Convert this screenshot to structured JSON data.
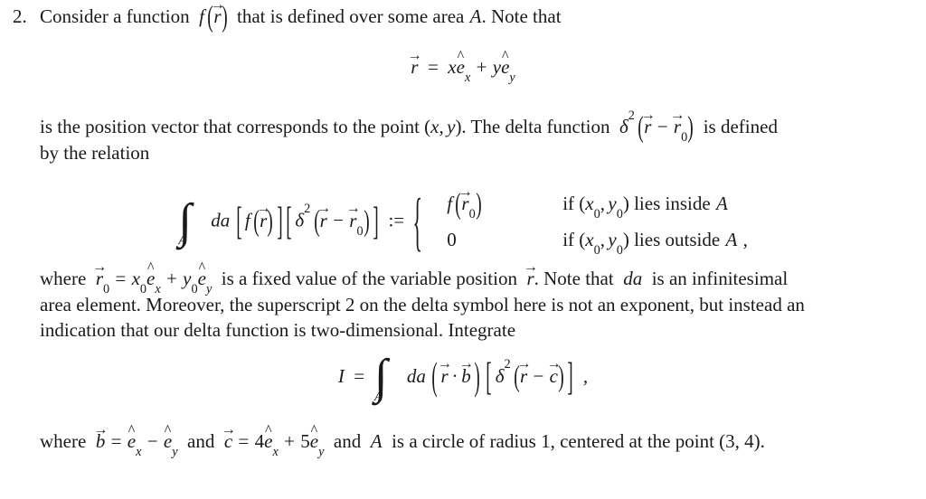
{
  "document": {
    "kind": "math-problem",
    "problem_number": "2.",
    "text_color": "#1a1a1a",
    "background_color": "#ffffff"
  },
  "intro": {
    "before_f": "Consider a function",
    "f_symbol": "f",
    "f_arg": "r",
    "after_f": "that is defined over some area",
    "area_symbol": "A",
    "tail": ". Note that"
  },
  "eq_position_vector": {
    "lhs": "r",
    "equals": "=",
    "term1_coeff": "x",
    "term1_basis": "e",
    "term1_sub": "x",
    "plus": "+",
    "term2_coeff": "y",
    "term2_basis": "e",
    "term2_sub": "y"
  },
  "para_position": {
    "line1_a": "is the position vector that corresponds to the point (",
    "line1_x": "x",
    "line1_comma": ",",
    "line1_y": "y",
    "line1_b": "). The delta function",
    "delta": "δ",
    "delta_sup": "2",
    "delta_arg_r": "r",
    "delta_minus": "−",
    "delta_arg_r0": "r",
    "delta_arg_r0_sub": "0",
    "line1_c": "is defined",
    "line2": "by the relation"
  },
  "eq_delta_definition": {
    "integral": "∫",
    "integral_limit": "A",
    "da": "da",
    "bracket_open": "[",
    "f_symbol": "f",
    "f_arg": "r",
    "bracket_close": "]",
    "delta": "δ",
    "delta_sup": "2",
    "arg_r": "r",
    "minus": "−",
    "arg_r0": "r",
    "arg_r0_sub": "0",
    "defined_as": ":=",
    "brace": "{",
    "case1_value_f": "f",
    "case1_value_arg": "r",
    "case1_value_arg_sub": "0",
    "case1_condition_if": "if (",
    "case1_condition_x": "x",
    "case1_condition_x_sub": "0",
    "case1_condition_comma": ",",
    "case1_condition_y": "y",
    "case1_condition_y_sub": "0",
    "case1_condition_tail": ") lies inside",
    "case1_condition_area": "A",
    "case2_value": "0",
    "case2_condition_if": "if (",
    "case2_condition_x": "x",
    "case2_condition_x_sub": "0",
    "case2_condition_comma": ",",
    "case2_condition_y": "y",
    "case2_condition_y_sub": "0",
    "case2_condition_tail": ") lies outside",
    "case2_condition_area": "A",
    "case2_condition_final": ","
  },
  "para_where": {
    "where": "where",
    "r0": "r",
    "r0_sub": "0",
    "equals": "=",
    "x0": "x",
    "x0_sub": "0",
    "ex": "e",
    "ex_sub": "x",
    "plus": "+",
    "y0": "y",
    "y0_sub": "0",
    "ey": "e",
    "ey_sub": "y",
    "mid1": "is a fixed value of the variable position",
    "r": "r",
    "mid2": ". Note that",
    "da": "da",
    "mid3": "is an infinitesimal",
    "line2": "area element. Moreover, the superscript 2 on the delta symbol here is not an exponent, but instead an",
    "line3": "indication that our delta function is two-dimensional. Integrate"
  },
  "eq_integral_I": {
    "I": "I",
    "equals": "=",
    "integral": "∫",
    "integral_limit": "A",
    "da": "da",
    "r": "r",
    "dot": "·",
    "b": "b",
    "delta": "δ",
    "delta_sup": "2",
    "arg_r": "r",
    "minus": "−",
    "arg_c": "c",
    "trailing_comma": ","
  },
  "para_final": {
    "where": "where",
    "b": "b",
    "equals1": "=",
    "ex1": "e",
    "ex1_sub": "x",
    "minus": "−",
    "ey1": "e",
    "ey1_sub": "y",
    "and1": "and",
    "c": "c",
    "equals2": "=",
    "c_coeff1": "4",
    "ex2": "e",
    "ex2_sub": "x",
    "plus": "+",
    "c_coeff2": "5",
    "ey2": "e",
    "ey2_sub": "y",
    "and2": "and",
    "A": "A",
    "tail": "is a circle of radius 1, centered at the point (3, 4)."
  }
}
